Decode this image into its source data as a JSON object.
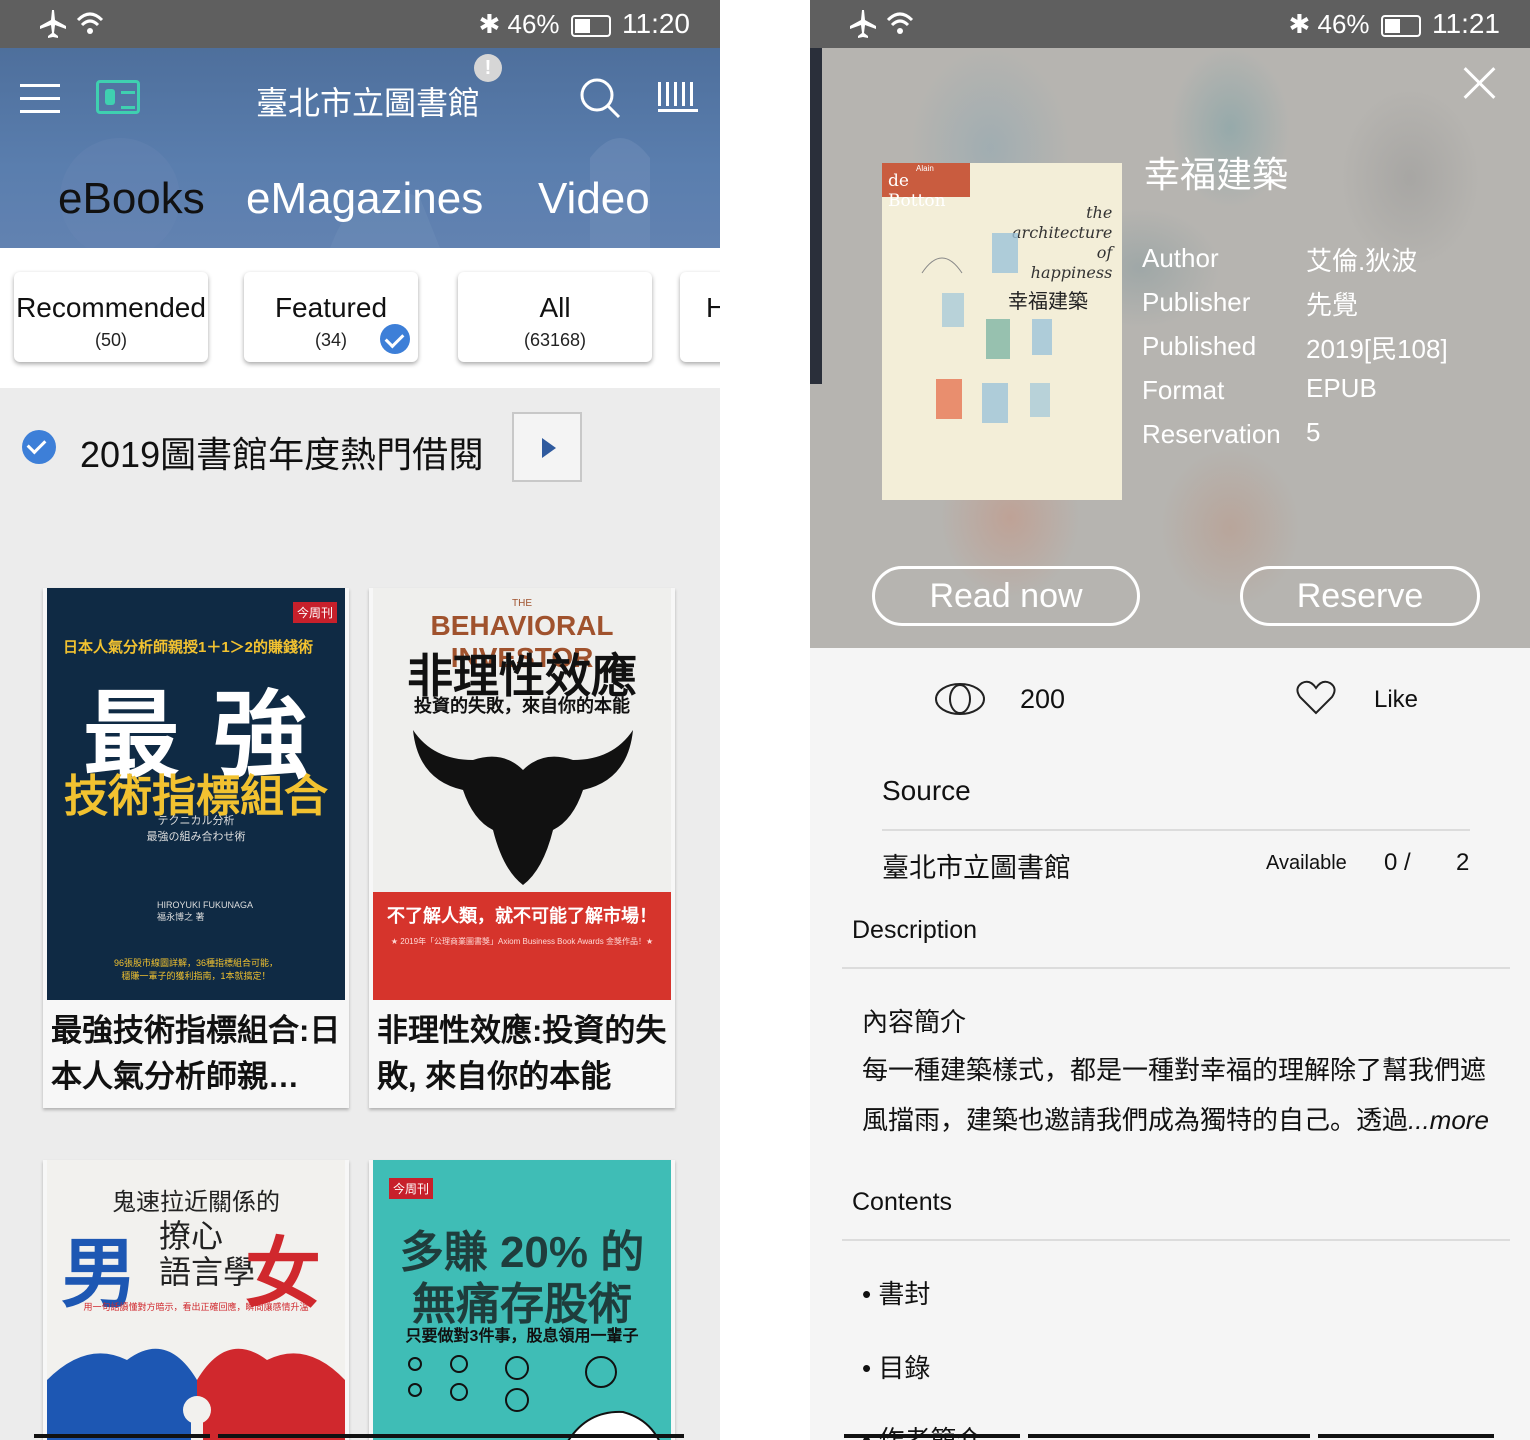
{
  "left": {
    "status": {
      "battery": "46%",
      "time": "11:20"
    },
    "header": {
      "library": "臺北市立圖書館",
      "notification_badge": "!"
    },
    "nav_tabs": [
      "eBooks",
      "eMagazines",
      "Video"
    ],
    "filters": [
      {
        "label": "Recommended",
        "count": "(50)"
      },
      {
        "label": "Featured",
        "count": "(34)"
      },
      {
        "label": "All",
        "count": "(63168)"
      },
      {
        "label": "H",
        "count": ""
      }
    ],
    "section": {
      "title": "2019圖書館年度熱門借閱"
    },
    "books": [
      {
        "title": "最強技術指標組合:日本人氣分析師親…",
        "cover": {
          "top_line": "日本人氣分析師親授1＋1＞2的賺錢術",
          "big": "最 強",
          "sub": "技術指標組合",
          "jp": "テクニカル分析\n最強の組み合わせ術",
          "author": "HIROYUKI FUKUNAGA\n福永博之 著",
          "foot": "96張股市線圖詳解，36種指標組合可能，\n穩賺一輩子的獲利指南，1本就搞定！",
          "badge": "今周刊"
        }
      },
      {
        "title": "非理性效應:投資的失敗, 來自你的本能",
        "cover": {
          "en": "BEHAVIORAL INVESTOR",
          "en_small": "THE",
          "big": "非理性效應",
          "sub": "投資的失敗，來自你的本能",
          "band": "不了解人類，就不可能了解市場！",
          "award": "★ 2019年「公理商業圖書獎」Axiom Business Book Awards 金獎作品！★"
        }
      },
      {
        "title": "",
        "cover": {
          "top": "鬼速拉近關係的",
          "big_l": "男",
          "mid": "撩心\n語言學",
          "big_r": "女",
          "sub": "用一句話讀懂對方暗示，看出正確回應，瞬間讓感情升溫"
        }
      },
      {
        "title": "",
        "cover": {
          "badge": "今周刊",
          "line1": "多賺 20% 的",
          "line2": "無痛存股術",
          "sub": "只要做對3件事，股息領用一輩子"
        }
      }
    ]
  },
  "right": {
    "status": {
      "battery": "46%",
      "time": "11:21"
    },
    "book": {
      "title": "幸福建築",
      "cover": {
        "brand": "de Botton",
        "brand_small": "Alain",
        "script": "the\narchitecture\nof\nhappiness",
        "zh": "幸福建築"
      },
      "meta": [
        {
          "key": "Author",
          "value": "艾倫.狄波"
        },
        {
          "key": "Publisher",
          "value": "先覺"
        },
        {
          "key": "Published",
          "value": "2019[民108]"
        },
        {
          "key": "Format",
          "value": "EPUB"
        },
        {
          "key": "Reservation",
          "value": "5"
        }
      ]
    },
    "actions": {
      "read_now": "Read now",
      "reserve": "Reserve"
    },
    "stats": {
      "views": "200",
      "like": "Like"
    },
    "source": {
      "heading": "Source",
      "library": "臺北市立圖書館",
      "available_label": "Available",
      "available": "0 /",
      "total": "2"
    },
    "description": {
      "heading": "Description",
      "intro": "內容簡介",
      "line1": "每一種建築樣式，都是一種對幸福的理解除了幫我們遮",
      "line2": "風擋雨，建築也邀請我們成為獨特的自己。透過",
      "more": "...more"
    },
    "contents": {
      "heading": "Contents",
      "items": [
        "• 書封",
        "• 目錄",
        "• 作者簡介"
      ]
    }
  },
  "colors": {
    "header_blue": "#5a7eae",
    "check_blue": "#3d7fd8",
    "status_gray": "#5f5f5f",
    "overlay_gray": "#b6b4b0"
  }
}
